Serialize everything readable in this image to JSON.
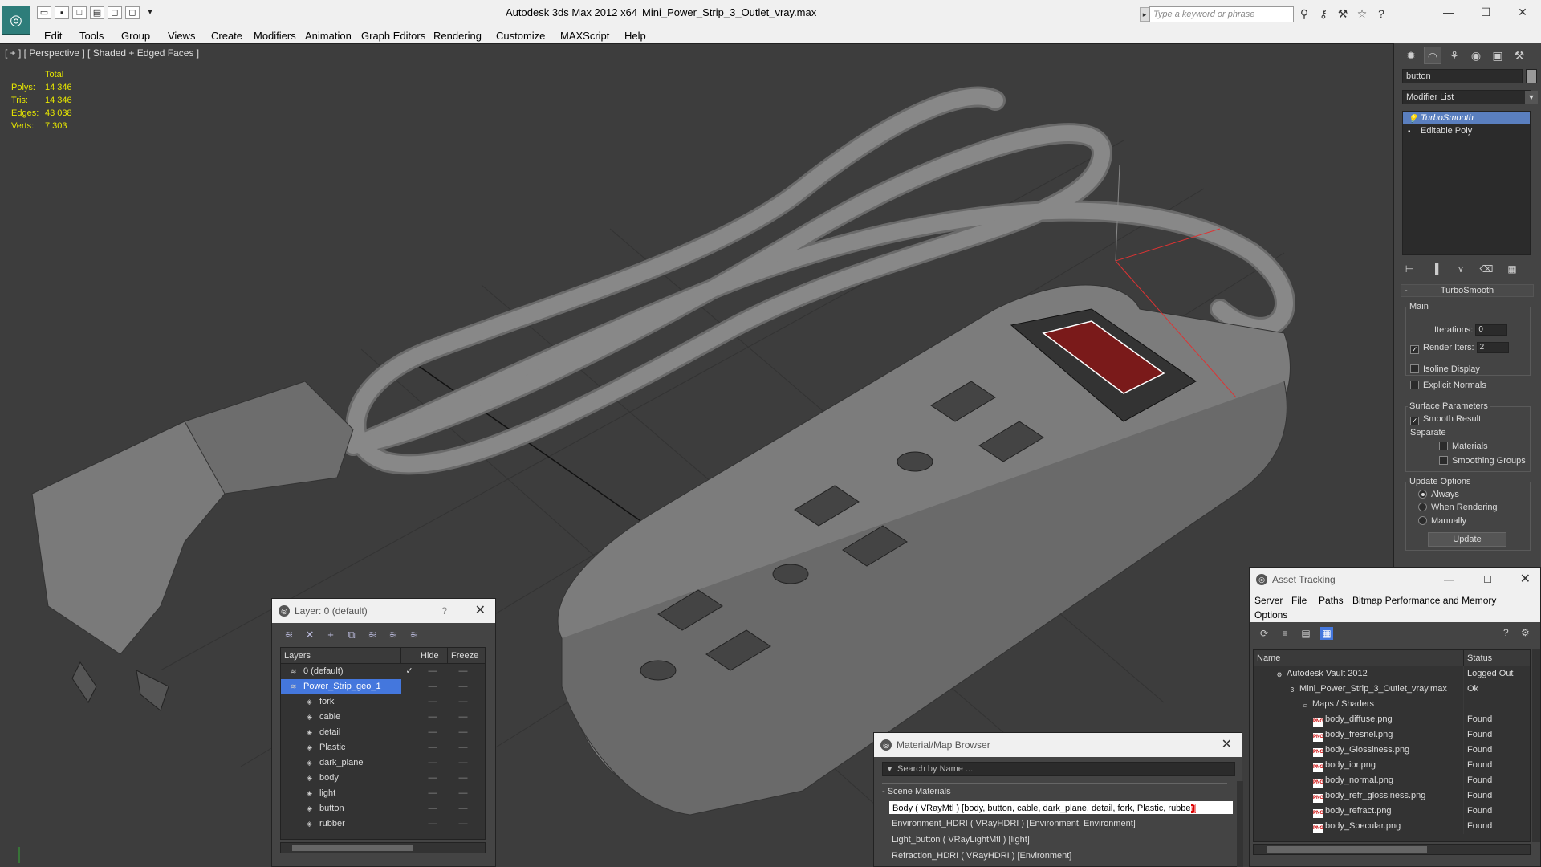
{
  "titlebar": {
    "app": "Autodesk 3ds Max  2012 x64",
    "file": "Mini_Power_Strip_3_Outlet_vray.max",
    "search_placeholder": "Type a keyword or phrase"
  },
  "menu": [
    "Edit",
    "Tools",
    "Group",
    "Views",
    "Create",
    "Modifiers",
    "Animation",
    "Graph Editors",
    "Rendering",
    "Customize",
    "MAXScript",
    "Help"
  ],
  "viewport": {
    "label": "[ + ] [ Perspective ] [ Shaded + Edged Faces ]",
    "stats_header": "Total",
    "stats": [
      {
        "k": "Polys:",
        "v": "14 346"
      },
      {
        "k": "Tris:",
        "v": "14 346"
      },
      {
        "k": "Edges:",
        "v": "43 038"
      },
      {
        "k": "Verts:",
        "v": "7 303"
      }
    ]
  },
  "command_panel": {
    "object_name": "button",
    "modifier_list": "Modifier List",
    "stack": [
      "TurboSmooth",
      "Editable Poly"
    ],
    "rollout": "TurboSmooth",
    "main_group": "Main",
    "iterations_label": "Iterations:",
    "iterations_value": "0",
    "render_iters_label": "Render Iters:",
    "render_iters_value": "2",
    "isoline": "Isoline Display",
    "explicit_normals": "Explicit Normals",
    "surface_group": "Surface Parameters",
    "smooth_result": "Smooth Result",
    "separate": "Separate",
    "materials": "Materials",
    "smoothing_groups": "Smoothing Groups",
    "update_group": "Update Options",
    "always": "Always",
    "when_rendering": "When Rendering",
    "manually": "Manually",
    "update_btn": "Update"
  },
  "layer_dialog": {
    "title": "Layer: 0 (default)",
    "help": "?",
    "col_layers": "Layers",
    "col_hide": "Hide",
    "col_freeze": "Freeze",
    "rows": [
      {
        "name": "0 (default)",
        "level": 0,
        "mark": "✓"
      },
      {
        "name": "Power_Strip_geo_1",
        "level": 0,
        "selected": true
      },
      {
        "name": "fork",
        "level": 1
      },
      {
        "name": "cable",
        "level": 1
      },
      {
        "name": "detail",
        "level": 1
      },
      {
        "name": "Plastic",
        "level": 1
      },
      {
        "name": "dark_plane",
        "level": 1
      },
      {
        "name": "body",
        "level": 1
      },
      {
        "name": "light",
        "level": 1
      },
      {
        "name": "button",
        "level": 1
      },
      {
        "name": "rubber",
        "level": 1
      }
    ]
  },
  "material_browser": {
    "title": "Material/Map Browser",
    "search": "Search by Name ...",
    "section": "- Scene Materials",
    "rows": [
      {
        "text": "Body  ( VRayMtl )  [body, button, cable, dark_plane, detail, fork, Plastic, rubbe",
        "tail": "r]",
        "selected": true
      },
      {
        "text": "Environment_HDRI  ( VRayHDRI )  [Environment, Environment]"
      },
      {
        "text": "Light_button  ( VRayLightMtl )  [light]"
      },
      {
        "text": "Refraction_HDRI  ( VRayHDRI )  [Environment]"
      }
    ]
  },
  "asset_tracking": {
    "title": "Asset Tracking",
    "menu": [
      "Server",
      "File",
      "Paths",
      "Bitmap Performance and Memory",
      "Options"
    ],
    "col_name": "Name",
    "col_status": "Status",
    "rows": [
      {
        "name": "Autodesk Vault 2012",
        "status": "Logged Out",
        "level": 0,
        "icon": "vault"
      },
      {
        "name": "Mini_Power_Strip_3_Outlet_vray.max",
        "status": "Ok",
        "level": 1,
        "icon": "max"
      },
      {
        "name": "Maps / Shaders",
        "status": "",
        "level": 2,
        "icon": "folder"
      },
      {
        "name": "body_diffuse.png",
        "status": "Found",
        "level": 3,
        "icon": "png"
      },
      {
        "name": "body_fresnel.png",
        "status": "Found",
        "level": 3,
        "icon": "png"
      },
      {
        "name": "body_Glossiness.png",
        "status": "Found",
        "level": 3,
        "icon": "png"
      },
      {
        "name": "body_ior.png",
        "status": "Found",
        "level": 3,
        "icon": "png"
      },
      {
        "name": "body_normal.png",
        "status": "Found",
        "level": 3,
        "icon": "png"
      },
      {
        "name": "body_refr_glossiness.png",
        "status": "Found",
        "level": 3,
        "icon": "png"
      },
      {
        "name": "body_refract.png",
        "status": "Found",
        "level": 3,
        "icon": "png"
      },
      {
        "name": "body_Specular.png",
        "status": "Found",
        "level": 3,
        "icon": "png"
      }
    ]
  },
  "colors": {
    "selection": "#4477dd",
    "viewport_bg": "#3d3d3d",
    "stats": "#e8e800"
  }
}
